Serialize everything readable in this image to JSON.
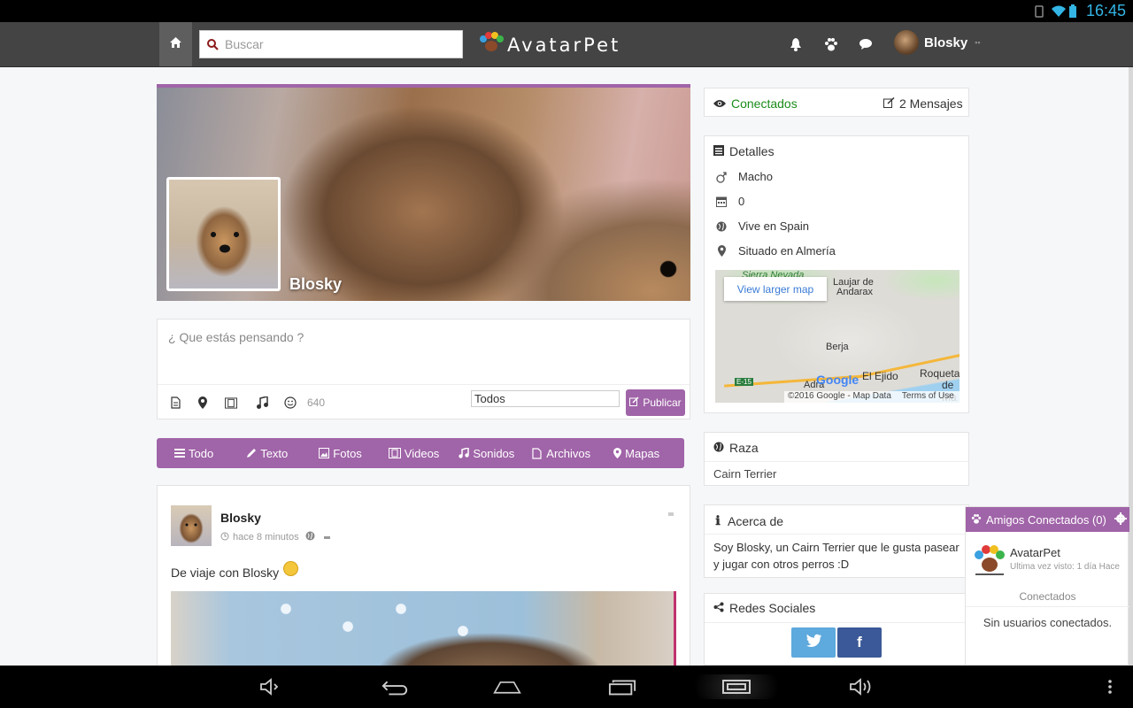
{
  "status_bar": {
    "time": "16:45"
  },
  "navbar": {
    "search_placeholder": "Buscar",
    "logo_text": "AvatarPet",
    "user_name": "Blosky"
  },
  "profile": {
    "name": "Blosky"
  },
  "composer": {
    "placeholder": "¿ Que estás pensando ?",
    "char_count": "640",
    "privacy": "Todos",
    "publish_label": "Publicar"
  },
  "filters": [
    {
      "label": "Todo",
      "icon": "list-icon"
    },
    {
      "label": "Texto",
      "icon": "pencil-icon"
    },
    {
      "label": "Fotos",
      "icon": "image-icon"
    },
    {
      "label": "Videos",
      "icon": "film-icon"
    },
    {
      "label": "Sonidos",
      "icon": "music-icon"
    },
    {
      "label": "Archivos",
      "icon": "file-icon"
    },
    {
      "label": "Mapas",
      "icon": "map-marker-icon"
    }
  ],
  "post": {
    "author": "Blosky",
    "time": "hace 8 minutos",
    "text": "De viaje con Blosky"
  },
  "status_panel": {
    "connected": "Conectados",
    "messages": "2 Mensajes"
  },
  "details": {
    "title": "Detalles",
    "gender": "Macho",
    "age": "0",
    "country": "Vive en Spain",
    "location": "Situado en Almería",
    "map": {
      "larger_link": "View larger map",
      "labels": [
        "Sierra Nevada",
        "Laujar de",
        "Andarax",
        "Berja",
        "El Ejido",
        "Adra",
        "Roquetas",
        "de Ma"
      ],
      "road": "E-15",
      "google": "Google",
      "copyright": "©2016 Google - Map Data",
      "terms": "Terms of Use"
    }
  },
  "breed": {
    "title": "Raza",
    "value": "Cairn Terrier"
  },
  "about": {
    "title": "Acerca de",
    "value": "Soy Blosky, un Cairn Terrier que le gusta pasear y jugar con otros perros :D"
  },
  "social": {
    "title": "Redes Sociales",
    "twitter": "twitter-icon",
    "facebook": "f"
  },
  "friends": {
    "title": "Amigos Conectados (0)",
    "name": "AvatarPet",
    "last_seen": "Ultima vez visto: 1 día Hace",
    "connected": "Conectados",
    "none": "Sin usuarios conectados."
  },
  "colors": {
    "accent": "#a064a8",
    "navbar": "#444444",
    "connected_green": "#1b8c1b"
  }
}
